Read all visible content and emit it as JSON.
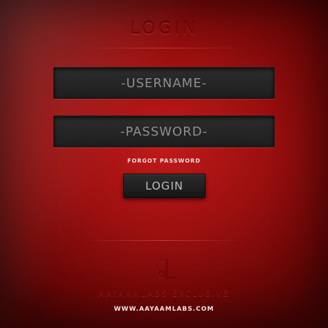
{
  "login_screen": {
    "title": "LOGIN",
    "username_placeholder": "-USERNAME-",
    "password_placeholder": "-PASSWORD-",
    "forgot_password_link": "FORGOT PASSWORD",
    "login_button_label": "LOGIN"
  },
  "branding": {
    "logo_icon": "al-monogram-icon",
    "name": "AAYAAMLABS EXCLUSIVE",
    "website": "WWW.AAYAAMLABS.COM"
  },
  "colors": {
    "background_red": "#a51212",
    "field_dark": "#222222",
    "button_dark": "#1e1e1e"
  }
}
